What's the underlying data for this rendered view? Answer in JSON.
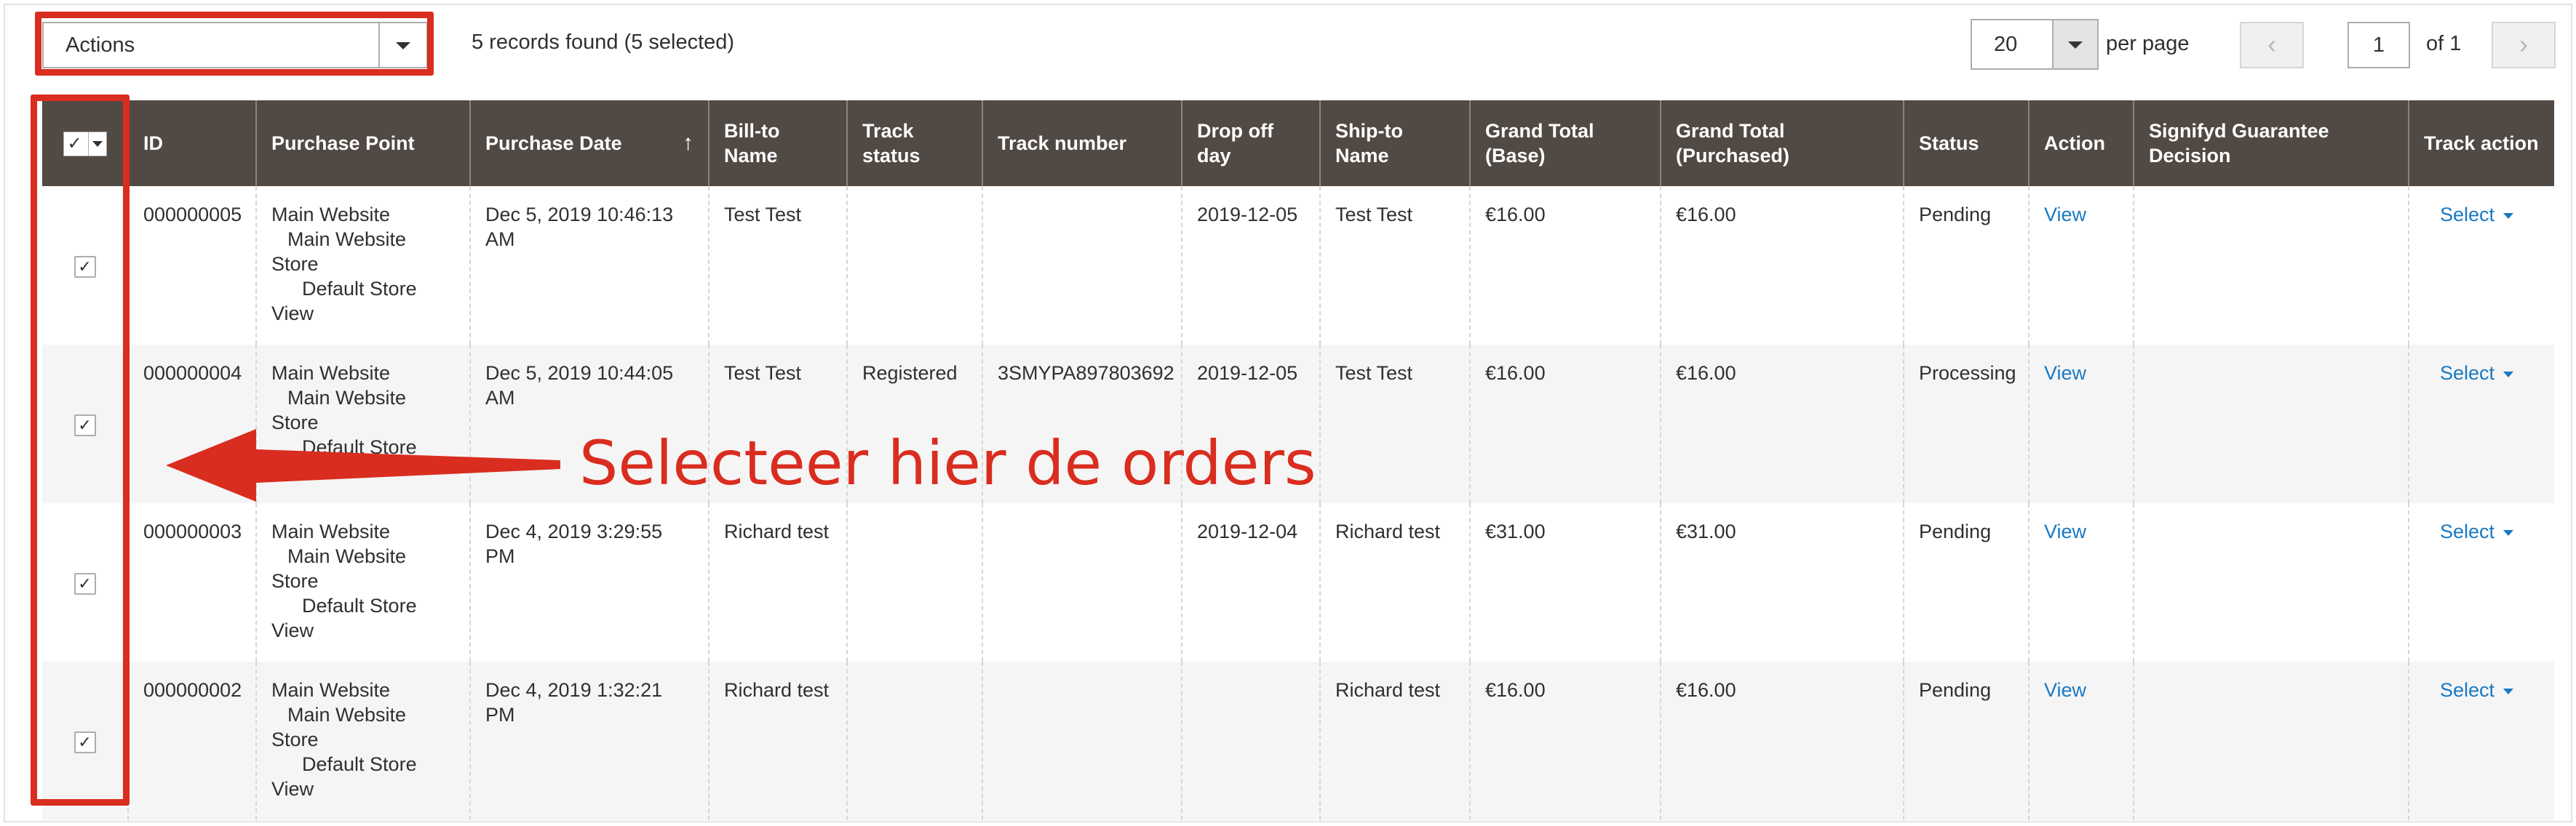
{
  "toolbar": {
    "actions_label": "Actions",
    "records_text": "5 records found (5 selected)",
    "per_page_value": "20",
    "per_page_label": "per page",
    "page_prev": "‹",
    "page_current": "1",
    "page_of": "of 1",
    "page_next": "›"
  },
  "table": {
    "headers": {
      "id": "ID",
      "purchase_point": "Purchase Point",
      "purchase_date": "Purchase Date",
      "purchase_date_sort": "↑",
      "bill_to": "Bill-to Name",
      "track_status": "Track status",
      "track_number": "Track number",
      "drop_off": "Drop off day",
      "ship_to": "Ship-to Name",
      "grand_base": "Grand Total (Base)",
      "grand_purchased": "Grand Total (Purchased)",
      "status": "Status",
      "action": "Action",
      "signifyd": "Signifyd Guarantee Decision",
      "track_action": "Track action"
    },
    "header_checkbox": "✓",
    "rows": [
      {
        "checked": "✓",
        "id": "000000005",
        "pp1": "Main Website",
        "pp2": "Main Website",
        "pp3": "Store",
        "pp4": "Default Store",
        "pp5": "View",
        "date": "Dec 5, 2019 10:46:13 AM",
        "bill_to": "Test Test",
        "track_status": "",
        "track_number": "",
        "drop_off": "2019-12-05",
        "ship_to": "Test Test",
        "grand_base": "€16.00",
        "grand_purchased": "€16.00",
        "status": "Pending",
        "action": "View",
        "signifyd": "",
        "track_action": "Select"
      },
      {
        "checked": "✓",
        "id": "000000004",
        "pp1": "Main Website",
        "pp2": "Main Website",
        "pp3": "Store",
        "pp4": "Default Store",
        "pp5": "View",
        "date": "Dec 5, 2019 10:44:05 AM",
        "bill_to": "Test Test",
        "track_status": "Registered",
        "track_number": "3SMYPA897803692",
        "drop_off": "2019-12-05",
        "ship_to": "Test Test",
        "grand_base": "€16.00",
        "grand_purchased": "€16.00",
        "status": "Processing",
        "action": "View",
        "signifyd": "",
        "track_action": "Select"
      },
      {
        "checked": "✓",
        "id": "000000003",
        "pp1": "Main Website",
        "pp2": "Main Website",
        "pp3": "Store",
        "pp4": "Default Store",
        "pp5": "View",
        "date": "Dec 4, 2019 3:29:55 PM",
        "bill_to": "Richard test",
        "track_status": "",
        "track_number": "",
        "drop_off": "2019-12-04",
        "ship_to": "Richard test",
        "grand_base": "€31.00",
        "grand_purchased": "€31.00",
        "status": "Pending",
        "action": "View",
        "signifyd": "",
        "track_action": "Select"
      },
      {
        "checked": "✓",
        "id": "000000002",
        "pp1": "Main Website",
        "pp2": "Main Website",
        "pp3": "Store",
        "pp4": "Default Store",
        "pp5": "View",
        "date": "Dec 4, 2019 1:32:21 PM",
        "bill_to": "Richard test",
        "track_status": "",
        "track_number": "",
        "drop_off": "",
        "ship_to": "Richard test",
        "grand_base": "€16.00",
        "grand_purchased": "€16.00",
        "status": "Pending",
        "action": "View",
        "signifyd": "",
        "track_action": "Select"
      }
    ]
  },
  "annotation": {
    "text": "Selecteer hier de orders",
    "color": "#d92d20"
  },
  "colors": {
    "header_bg": "#514943",
    "link": "#1979c3",
    "row_alt": "#f5f5f5"
  }
}
